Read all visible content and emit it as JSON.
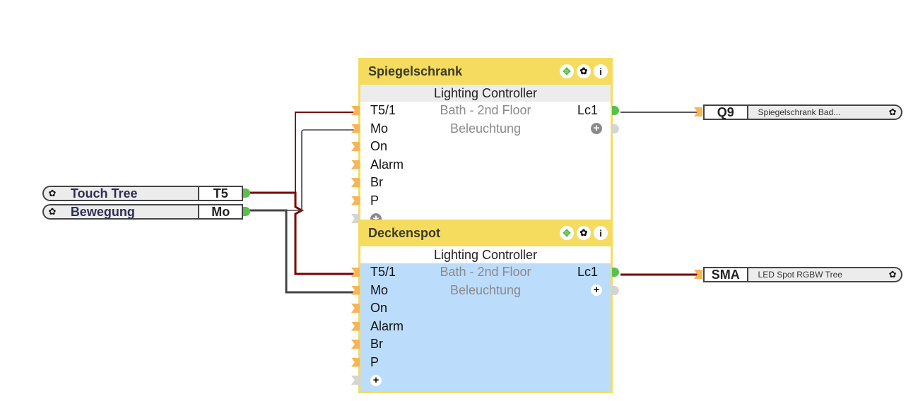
{
  "colors": {
    "block_header": "#f5dc5f",
    "selected_body": "#bcdcfb",
    "input_port": "#f7b556",
    "output_port": "#5cbf4a",
    "unused_port": "#d5d4d0",
    "wire_digital": "#7a0000",
    "wire_analog": "#444444"
  },
  "inputs": [
    {
      "name": "Touch Tree",
      "code": "T5",
      "icon": "gear-icon"
    },
    {
      "name": "Bewegung",
      "code": "Mo",
      "icon": "gear-icon"
    }
  ],
  "blocks": [
    {
      "title": "Spiegelschrank",
      "type": "Lighting Controller",
      "room": "Bath - 2nd Floor",
      "category": "Beleuchtung",
      "selected": false,
      "header_icons": [
        "move-icon",
        "gear-icon",
        "info-icon"
      ],
      "inputs": [
        "T5/1",
        "Mo",
        "On",
        "Alarm",
        "Br",
        "P"
      ],
      "outputs": [
        "Lc1"
      ]
    },
    {
      "title": "Deckenspot",
      "type": "Lighting Controller",
      "room": "Bath - 2nd Floor",
      "category": "Beleuchtung",
      "selected": true,
      "header_icons": [
        "move-icon",
        "gear-icon",
        "info-icon"
      ],
      "inputs": [
        "T5/1",
        "Mo",
        "On",
        "Alarm",
        "Br",
        "P"
      ],
      "outputs": [
        "Lc1"
      ]
    }
  ],
  "outputs": [
    {
      "code": "Q9",
      "description": "Spiegelschrank  Bad...",
      "icon": "gear-icon"
    },
    {
      "code": "SMA",
      "description": "LED Spot RGBW Tree",
      "icon": "gear-icon"
    }
  ],
  "glyphs": {
    "gear": "✿",
    "info": "i",
    "move": "✥",
    "plus": "+"
  }
}
